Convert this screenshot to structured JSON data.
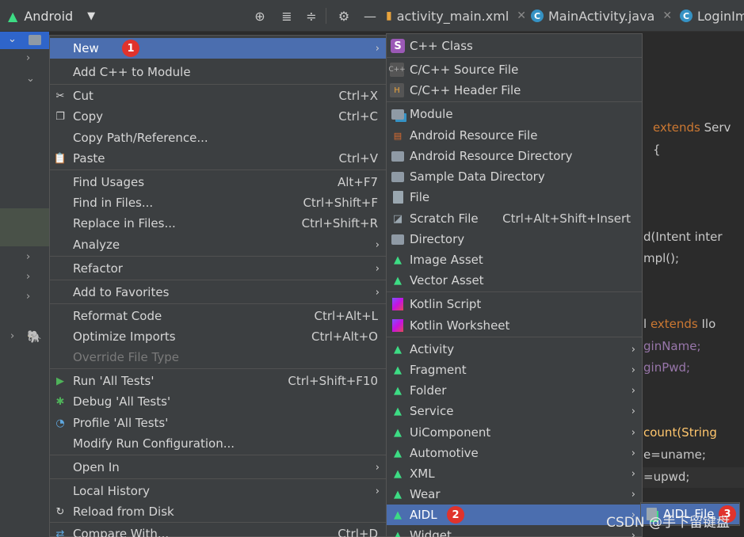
{
  "toolbar": {
    "project_view": "Android",
    "tabs": [
      {
        "label": "activity_main.xml"
      },
      {
        "label": "MainActivity.java"
      },
      {
        "label": "LoginIm"
      }
    ]
  },
  "editor_lines": [
    {
      "pre": "",
      "kw": "extends",
      "post": " Serv"
    },
    {
      "pre": "",
      "kw": "",
      "post": "{"
    },
    {
      "pre": "d(Intent inter",
      "kw": "",
      "post": ""
    },
    {
      "pre": "mpl();",
      "kw": "",
      "post": ""
    },
    {
      "pre": "l ",
      "kw": "extends",
      "post": " Ilo"
    },
    {
      "pre": "ginName;",
      "kw": "",
      "post": ""
    },
    {
      "pre": "ginPwd;",
      "kw": "",
      "post": ""
    },
    {
      "pre": "count(String",
      "kw": "",
      "post": ""
    },
    {
      "pre": "e=uname;",
      "kw": "",
      "post": ""
    },
    {
      "pre": "=upwd;",
      "kw": "",
      "post": ""
    }
  ],
  "context_menu": [
    {
      "label": "New",
      "submenu": true,
      "selected": true,
      "badge": "1"
    },
    {
      "label": "Add C++ to Module"
    },
    {
      "label": "Cut",
      "shortcut": "Ctrl+X",
      "icon": "scissors-icon"
    },
    {
      "label": "Copy",
      "shortcut": "Ctrl+C",
      "icon": "copy-icon"
    },
    {
      "label": "Copy Path/Reference..."
    },
    {
      "label": "Paste",
      "shortcut": "Ctrl+V",
      "icon": "paste-icon"
    },
    {
      "label": "Find Usages",
      "shortcut": "Alt+F7"
    },
    {
      "label": "Find in Files...",
      "shortcut": "Ctrl+Shift+F"
    },
    {
      "label": "Replace in Files...",
      "shortcut": "Ctrl+Shift+R"
    },
    {
      "label": "Analyze",
      "submenu": true
    },
    {
      "label": "Refactor",
      "submenu": true
    },
    {
      "label": "Add to Favorites",
      "submenu": true
    },
    {
      "label": "Reformat Code",
      "shortcut": "Ctrl+Alt+L"
    },
    {
      "label": "Optimize Imports",
      "shortcut": "Ctrl+Alt+O"
    },
    {
      "label": "Override File Type",
      "disabled": true
    },
    {
      "label": "Run 'All Tests'",
      "shortcut": "Ctrl+Shift+F10",
      "icon": "run-icon"
    },
    {
      "label": "Debug 'All Tests'",
      "icon": "debug-icon"
    },
    {
      "label": "Profile 'All Tests'",
      "icon": "profile-icon"
    },
    {
      "label": "Modify Run Configuration..."
    },
    {
      "label": "Open In",
      "submenu": true
    },
    {
      "label": "Local History",
      "submenu": true
    },
    {
      "label": "Reload from Disk",
      "icon": "reload-icon"
    },
    {
      "label": "Compare With...",
      "shortcut": "Ctrl+D",
      "icon": "compare-icon"
    }
  ],
  "new_submenu": [
    {
      "label": "C++ Class",
      "icon": "s-icon"
    },
    {
      "label": "C/C++ Source File",
      "icon": "cpp-source-icon"
    },
    {
      "label": "C/C++ Header File",
      "icon": "cpp-header-icon"
    },
    {
      "label": "Module",
      "icon": "module-icon"
    },
    {
      "label": "Android Resource File",
      "icon": "resource-file-icon"
    },
    {
      "label": "Android Resource Directory",
      "icon": "folder-icon"
    },
    {
      "label": "Sample Data Directory",
      "icon": "folder-icon"
    },
    {
      "label": "File",
      "icon": "file-icon"
    },
    {
      "label": "Scratch File",
      "shortcut": "Ctrl+Alt+Shift+Insert",
      "icon": "scratch-icon"
    },
    {
      "label": "Directory",
      "icon": "folder-icon"
    },
    {
      "label": "Image Asset",
      "icon": "android-icon"
    },
    {
      "label": "Vector Asset",
      "icon": "android-icon"
    },
    {
      "label": "Kotlin Script",
      "icon": "kotlin-icon"
    },
    {
      "label": "Kotlin Worksheet",
      "icon": "kotlin-icon"
    },
    {
      "label": "Activity",
      "submenu": true,
      "icon": "android-icon"
    },
    {
      "label": "Fragment",
      "submenu": true,
      "icon": "android-icon"
    },
    {
      "label": "Folder",
      "submenu": true,
      "icon": "android-icon"
    },
    {
      "label": "Service",
      "submenu": true,
      "icon": "android-icon"
    },
    {
      "label": "UiComponent",
      "submenu": true,
      "icon": "android-icon"
    },
    {
      "label": "Automotive",
      "submenu": true,
      "icon": "android-icon"
    },
    {
      "label": "XML",
      "submenu": true,
      "icon": "android-icon"
    },
    {
      "label": "Wear",
      "submenu": true,
      "icon": "android-icon"
    },
    {
      "label": "AIDL",
      "submenu": true,
      "selected": true,
      "badge": "2",
      "icon": "android-icon"
    },
    {
      "label": "Widget",
      "submenu": true,
      "icon": "android-icon"
    }
  ],
  "aidl_submenu": [
    {
      "label": "AIDL File",
      "badge": "3"
    }
  ],
  "watermark": "CSDN @手下留键盘"
}
